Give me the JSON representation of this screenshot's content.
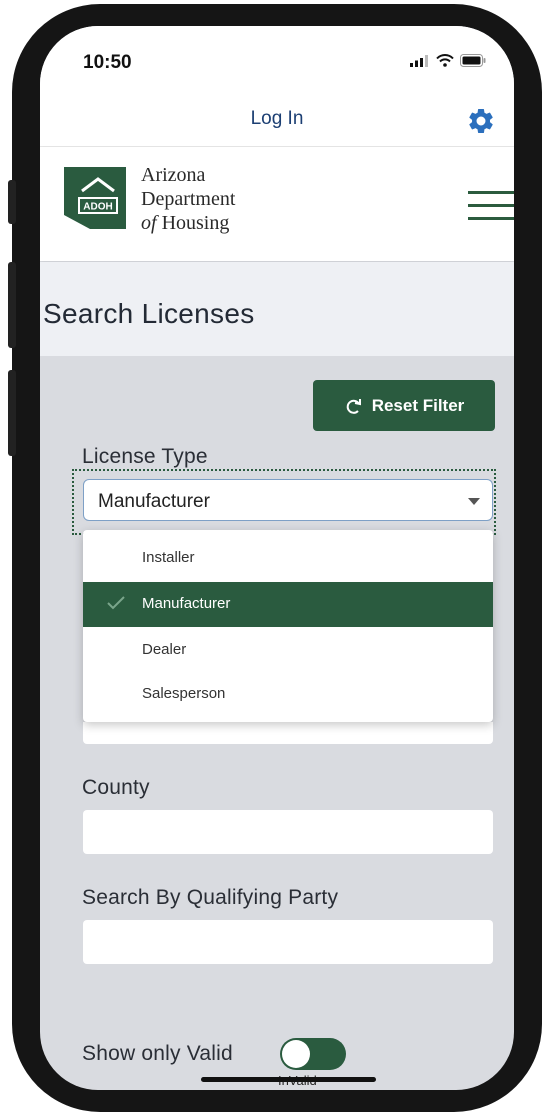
{
  "status_bar": {
    "time": "10:50",
    "icons": [
      "signal-icon",
      "wifi-icon",
      "battery-icon"
    ]
  },
  "nav": {
    "title": "Log In",
    "settings_icon": "gear-icon"
  },
  "brand": {
    "logo_text": "ADOH",
    "name_lines": [
      "Arizona",
      "Department",
      "of",
      "Housing"
    ],
    "menu_icon": "hamburger-menu-icon"
  },
  "page": {
    "title": "Search Licenses"
  },
  "reset_button": {
    "label": "Reset Filter",
    "icon": "redo-arrow-icon"
  },
  "license_type": {
    "label": "License Type",
    "selected": "Manufacturer",
    "options": [
      "Installer",
      "Manufacturer",
      "Dealer",
      "Salesperson"
    ]
  },
  "county": {
    "label": "County",
    "value": ""
  },
  "qualifying_party": {
    "label": "Search By Qualifying Party",
    "value": ""
  },
  "valid_toggle": {
    "label": "Show only Valid",
    "state_label": "InValid"
  },
  "colors": {
    "brand_green": "#2a5b3f",
    "nav_blue": "#1c3f73",
    "gear_blue": "#2b6fbd"
  }
}
